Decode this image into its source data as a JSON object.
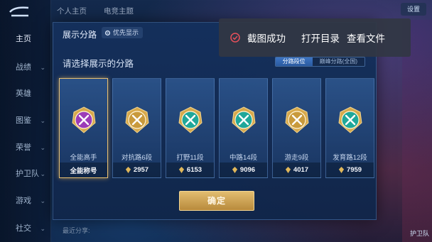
{
  "top_tabs": [
    "个人主页",
    "电竞主题"
  ],
  "top_right_label": "设置",
  "sidebar": {
    "items": [
      {
        "label": "主页",
        "active": true
      },
      {
        "label": "战绩",
        "chevron": true
      },
      {
        "label": "英雄"
      },
      {
        "label": "图鉴",
        "chevron": true
      },
      {
        "label": "荣誉",
        "chevron": true
      },
      {
        "label": "护卫队",
        "chevron": true
      },
      {
        "label": "游戏",
        "chevron": true
      },
      {
        "label": "社交",
        "chevron": true
      }
    ]
  },
  "dialog": {
    "title": "展示分路",
    "priority_label": "优先显示",
    "hint": "请选择展示的分路",
    "segments": [
      {
        "label": "分路段位",
        "on": true
      },
      {
        "label": "巅峰分路(全国)",
        "on": false
      }
    ],
    "cards": [
      {
        "label": "全能高手",
        "footer": "全能称号",
        "coin": false,
        "selected": true,
        "badge": "all-round-badge-icon",
        "color": "#9b3bb8"
      },
      {
        "label": "对抗路6段",
        "footer": "2957",
        "coin": true,
        "selected": false,
        "badge": "clash-lane-badge-icon",
        "color": "#c99a3c"
      },
      {
        "label": "打野11段",
        "footer": "6153",
        "coin": true,
        "selected": false,
        "badge": "jungle-badge-icon",
        "color": "#1fa79a"
      },
      {
        "label": "中路14段",
        "footer": "9096",
        "coin": true,
        "selected": false,
        "badge": "mid-lane-badge-icon",
        "color": "#1fa79a"
      },
      {
        "label": "游走9段",
        "footer": "4017",
        "coin": true,
        "selected": false,
        "badge": "roam-badge-icon",
        "color": "#c99a3c"
      },
      {
        "label": "发育路12段",
        "footer": "7959",
        "coin": true,
        "selected": false,
        "badge": "farm-lane-badge-icon",
        "color": "#1fa79a"
      }
    ],
    "confirm_label": "确定"
  },
  "toast": {
    "message": "截图成功",
    "open_dir": "打开目录",
    "view_file": "查看文件"
  },
  "bottom_share": "最近分享:",
  "bottom_right": "护卫队"
}
